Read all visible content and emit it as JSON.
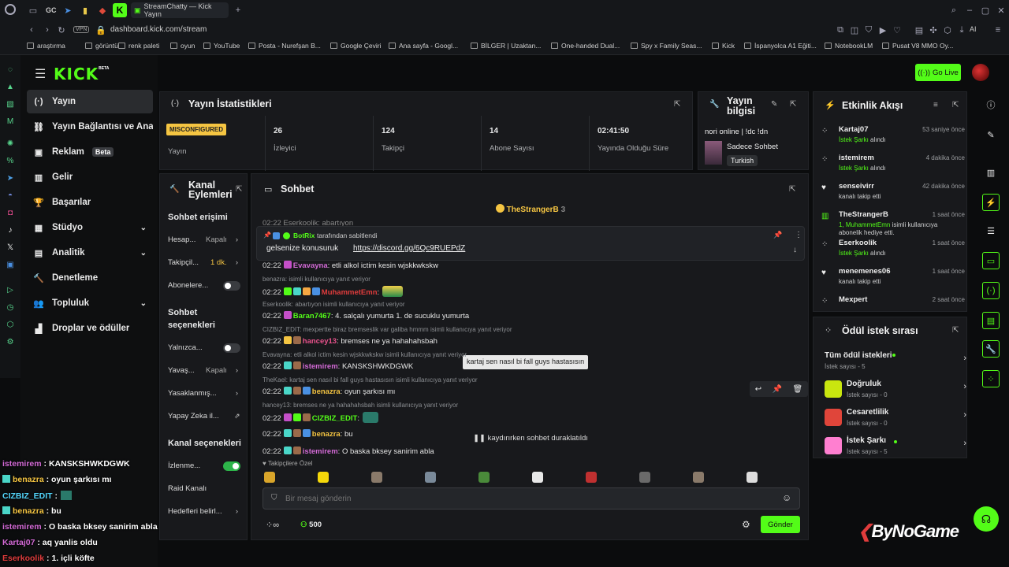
{
  "browser": {
    "tabs": [
      "GC",
      "StreamChatty — Kick Yayın"
    ],
    "address": "dashboard.kick.com/stream",
    "vpn": "VPN",
    "ai": "AI",
    "bookmarks": [
      "araştırma",
      "görüntü",
      "renk paleti",
      "oyun",
      "YouTube",
      "Posta - Nurefşan B...",
      "Google Çeviri",
      "Ana sayfa - Googl...",
      "BİLGER | Uzaktan...",
      "One-handed Dual...",
      "Spy x Family Seas...",
      "Kick",
      "İspanyolca A1 Eğiti...",
      "NotebookLM",
      "Pusat V8 MMO Oy..."
    ]
  },
  "kick": {
    "logo": "KICK",
    "logo_sup": "BETA",
    "go_live": "Go Live",
    "nav": [
      {
        "label": "Yayın",
        "icon": "(·)"
      },
      {
        "label": "Yayın Bağlantısı ve Anahtar",
        "icon": "⛓"
      },
      {
        "label": "Reklam",
        "icon": "▣",
        "badge": "Beta"
      },
      {
        "label": "Gelir",
        "icon": "▥"
      },
      {
        "label": "Başarılar",
        "icon": "🏆"
      },
      {
        "label": "Stüdyo",
        "icon": "▦"
      },
      {
        "label": "Analitik",
        "icon": "▤"
      },
      {
        "label": "Denetleme",
        "icon": "🔨"
      },
      {
        "label": "Topluluk",
        "icon": "👥"
      },
      {
        "label": "Droplar ve ödüller",
        "icon": "▟"
      }
    ]
  },
  "stats": {
    "title": "Yayın İstatistikleri",
    "status_badge": "MISCONFIGURED",
    "status_label": "Yayın",
    "cells": [
      {
        "value": "26",
        "label": "İzleyici"
      },
      {
        "value": "124",
        "label": "Takipçi"
      },
      {
        "value": "14",
        "label": "Abone Sayısı"
      },
      {
        "value": "02:41:50",
        "label": "Yayında Olduğu Süre"
      }
    ]
  },
  "stream_info": {
    "title_line1": "Yayın",
    "title_line2": "bilgisi",
    "stream_title": "nori online | !dc !dn",
    "category": "Sadece Sohbet",
    "language": "Turkish"
  },
  "channel_actions": {
    "title_line1": "Kanal",
    "title_line2": "Eylemleri",
    "section1": "Sohbet erişimi",
    "rows1": [
      {
        "label": "Hesap...",
        "value": "Kapalı"
      },
      {
        "label": "Takipçil...",
        "value": "1 dk."
      },
      {
        "label": "Abonelere..."
      }
    ],
    "section2_line1": "Sohbet",
    "section2_line2": "seçenekleri",
    "rows2": [
      {
        "label": "Yalnızca..."
      },
      {
        "label": "Yavaş...",
        "value": "Kapalı"
      },
      {
        "label": "Yasaklanmış..."
      },
      {
        "label": "Yapay Zeka il..."
      }
    ],
    "section3": "Kanal seçenekleri",
    "rows3": [
      {
        "label": "İzlenme..."
      },
      {
        "label": "Raid Kanalı"
      },
      {
        "label": "Hedefleri belirl..."
      }
    ]
  },
  "chat": {
    "title": "Sohbet",
    "top_user": "TheStrangerB",
    "top_count": "3",
    "pinned_by": "BotRix",
    "pinned_suffix": "tarafından sabitlendi",
    "pinned_text": "gelsenize konusuruk",
    "pinned_link": "https://discord.gg/6Qc9RUEPdZ",
    "partial_top": "02:22 Eserkoolik: abartıyon",
    "messages": [
      {
        "time": "02:22",
        "user": "Evavayna",
        "text": ": etli alkol ictim kesin wjskkwkskw",
        "color": "#d36ad6",
        "reply": ""
      },
      {
        "time": "02:22",
        "user": "MuhammetEmn",
        "text": ":",
        "color": "#e03c3c",
        "reply": "benazra: isimli kullanıcıya yanıt veriyor"
      },
      {
        "time": "02:22",
        "user": "Baran7467",
        "text": ": 4. salçalı yumurta 1. de sucuklu yumurta",
        "color": "#53fc18",
        "reply": "Eserkoolik: abartıyon isimli kullanıcıya yanıt veriyor"
      },
      {
        "time": "02:22",
        "user": "hancey13",
        "text": ": bremses ne ya hahahahsbah",
        "color": "#e8528c",
        "reply": "CIZBIZ_EDIT: mexpertte biraz bremseslik var galiba hmmm isimli kullanıcıya yanıt veriyor"
      },
      {
        "time": "02:22",
        "user": "istemirem",
        "text": ": KANSKSHWKDGWK",
        "color": "#d36ad6",
        "reply": "Evavayna: etli alkol ictim kesin wjskkwkskw isimli kullanıcıya yanıt veriyor"
      },
      {
        "time": "02:22",
        "user": "benazra",
        "text": ": oyun şarkısı mı",
        "color": "#f5c542",
        "reply": "TheKael: kartaj sen nasıl bi fall guys hastasısın isimli kullanıcıya yanıt veriyor"
      },
      {
        "time": "02:22",
        "user": "CIZBIZ_EDIT",
        "text": ":",
        "color": "#53fc18",
        "reply": "hancey13: bremses ne ya hahahahsbah isimli kullanıcıya yanıt veriyor"
      },
      {
        "time": "02:22",
        "user": "benazra",
        "text": ": bu",
        "color": "#f5c542",
        "reply": ""
      },
      {
        "time": "02:22",
        "user": "istemirem",
        "text": ": O baska bksey sanirim abla",
        "color": "#d36ad6",
        "reply": ""
      }
    ],
    "tooltip": "kartaj sen nasıl bi fall guys hastasısın",
    "paused": "kaydırırken sohbet duraklatıldı",
    "followers_only": "Takipçilere Özel",
    "input_placeholder": "Bir mesaj gönderin",
    "points": "500",
    "send": "Gönder"
  },
  "activity": {
    "title": "Etkinlik Akışı",
    "items": [
      {
        "name": "Kartaj07",
        "sub_green": "İstek Şarkı",
        "sub": " alındı",
        "time": "53 saniye önce",
        "icon": "gift"
      },
      {
        "name": "istemirem",
        "sub_green": "İstek Şarkı",
        "sub": " alındı",
        "time": "4 dakika önce",
        "icon": "gift"
      },
      {
        "name": "senseivirr",
        "sub_green": "",
        "sub": "kanalı takip etti",
        "time": "42 dakika önce",
        "icon": "heart"
      },
      {
        "name": "TheStrangerB",
        "sub_green": "1, MuhammetEmn",
        "sub": " isimli kullanıcıya abonelik hediye etti.",
        "time": "1 saat önce",
        "icon": "sub"
      },
      {
        "name": "Eserkoolik",
        "sub_green": "İstek Şarkı",
        "sub": " alındı",
        "time": "1 saat önce",
        "icon": "gift"
      },
      {
        "name": "menemenes06",
        "sub_green": "",
        "sub": "kanalı takip etti",
        "time": "1 saat önce",
        "icon": "heart"
      },
      {
        "name": "Mexpert",
        "sub_green": "",
        "sub": "",
        "time": "2 saat önce",
        "icon": "gift"
      }
    ]
  },
  "rewards": {
    "title": "Ödül istek sırası",
    "all_label": "Tüm ödül istekleri",
    "all_sub": "İstek sayısı - 5",
    "items": [
      {
        "label": "Doğruluk",
        "sub": "İstek sayısı - 0",
        "color": "#c9e60f"
      },
      {
        "label": "Cesaretlilik",
        "sub": "İstek sayısı - 0",
        "color": "#e0453a"
      },
      {
        "label": "İstek Şarkı",
        "sub": "İstek sayısı - 5",
        "color": "#ff7fd0"
      }
    ]
  },
  "watermark": "ByNoGame",
  "overlay_chat": [
    {
      "user": "istemirem",
      "text": " : KANSKSHWKDGWK",
      "color": "#d36ad6"
    },
    {
      "user": "benazra",
      "text": " : oyun şarkısı mı",
      "color": "#f5c542"
    },
    {
      "user": "CIZBIZ_EDIT",
      "text": " :",
      "color": "#53d6fc"
    },
    {
      "user": "benazra",
      "text": " : bu",
      "color": "#f5c542"
    },
    {
      "user": "istemirem",
      "text": " : O baska bksey sanirim abla",
      "color": "#d36ad6"
    },
    {
      "user": "Kartaj07",
      "text": " : aq yanlis oldu",
      "color": "#d36ad6"
    },
    {
      "user": "Eserkoolik",
      "text": " : 1. içli köfte",
      "color": "#e03c3c"
    }
  ]
}
